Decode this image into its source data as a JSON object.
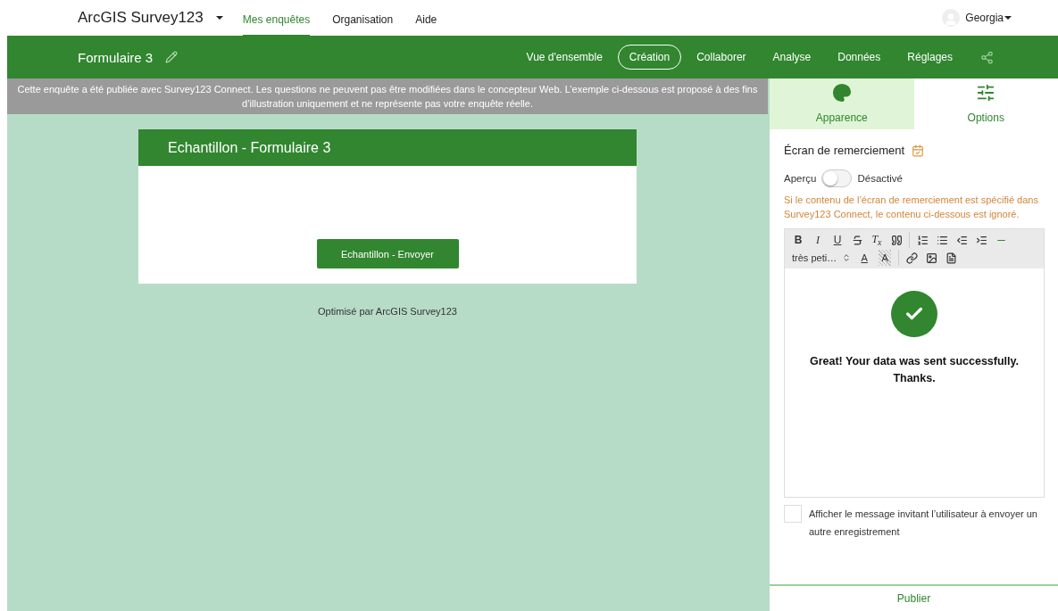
{
  "app": {
    "title": "ArcGIS Survey123"
  },
  "nav": [
    {
      "label": "Mes enquêtes",
      "selected": true
    },
    {
      "label": "Organisation",
      "selected": false
    },
    {
      "label": "Aide",
      "selected": false
    }
  ],
  "user": {
    "name": "Georgia"
  },
  "survey": {
    "title": "Formulaire 3"
  },
  "design_tabs": [
    {
      "label": "Vue d'ensemble",
      "selected": false
    },
    {
      "label": "Création",
      "selected": true
    },
    {
      "label": "Collaborer",
      "selected": false
    },
    {
      "label": "Analyse",
      "selected": false
    },
    {
      "label": "Données",
      "selected": false
    },
    {
      "label": "Réglages",
      "selected": false
    }
  ],
  "banner": "Cette enquête a été publiée avec Survey123 Connect. Les questions ne peuvent pas être modifiées dans le concepteur Web. L’exemple ci-dessous est proposé à des fins d’illustration uniquement et ne représente pas votre enquête réelle.",
  "form": {
    "header": "Echantillon - Formulaire 3",
    "submit": "Echantillon - Envoyer",
    "footer": "Optimisé par ArcGIS Survey123"
  },
  "panel_tabs": [
    {
      "label": "Apparence",
      "kind": "palette",
      "selected": false
    },
    {
      "label": "Options",
      "kind": "sliders",
      "selected": true
    }
  ],
  "thanks": {
    "title": "Écran de remerciement",
    "preview_label": "Aperçu",
    "preview_on": false,
    "preview_state": "Désactivé",
    "warning": "Si le contenu de l’écran de remerciement est spécifié dans Survey123 Connect, le contenu ci-dessous est ignoré.",
    "message": "Great! Your data was sent successfully. Thanks."
  },
  "toolbar": [
    [
      [
        {
          "kind": "bold",
          "label": "B",
          "active": false
        },
        {
          "kind": "italic",
          "label": "I",
          "active": false
        },
        {
          "kind": "underline",
          "label": "U",
          "active": false
        },
        {
          "kind": "strike",
          "active": false
        },
        {
          "kind": "clear",
          "label": "T$_{x}$",
          "active": false
        },
        {
          "kind": "quote",
          "active": false
        }
      ],
      [
        {
          "kind": "ordered-list",
          "active": false
        },
        {
          "kind": "bullet-list",
          "active": false
        },
        {
          "kind": "outdent",
          "active": false
        },
        {
          "kind": "indent",
          "active": false
        },
        {
          "kind": "rule",
          "active": true
        }
      ]
    ],
    [
      [
        {
          "kind": "size",
          "label": "très peti…",
          "active": false
        },
        {
          "kind": "font-color",
          "label": "A",
          "active": false
        },
        {
          "kind": "bg-color",
          "label": "A",
          "active": false
        }
      ],
      [
        {
          "kind": "link",
          "active": false
        },
        {
          "kind": "image",
          "active": false
        },
        {
          "kind": "template",
          "active": false
        }
      ]
    ]
  ],
  "another": {
    "label": "Afficher le message invitant l’utilisateur à envoyer un autre enregistrement",
    "checked": false
  },
  "publish": "Publier"
}
